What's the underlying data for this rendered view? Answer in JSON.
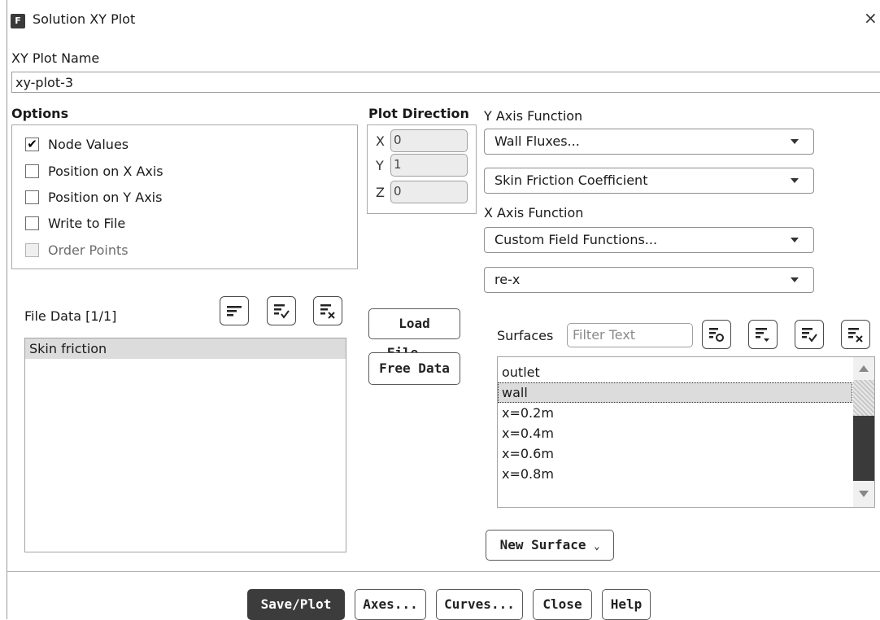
{
  "window": {
    "app_icon": "F",
    "title": "Solution XY Plot",
    "close_glyph": "×"
  },
  "plot_name": {
    "label": "XY Plot Name",
    "value": "xy-plot-3"
  },
  "options": {
    "label": "Options",
    "items": [
      {
        "label": "Node Values",
        "checked": true,
        "disabled": false
      },
      {
        "label": "Position on X Axis",
        "checked": false,
        "disabled": false
      },
      {
        "label": "Position on Y Axis",
        "checked": false,
        "disabled": false
      },
      {
        "label": "Write to File",
        "checked": false,
        "disabled": false
      },
      {
        "label": "Order Points",
        "checked": false,
        "disabled": true
      }
    ]
  },
  "plot_direction": {
    "label": "Plot Direction",
    "x_label": "X",
    "x_value": "0",
    "y_label": "Y",
    "y_value": "1",
    "z_label": "Z",
    "z_value": "0"
  },
  "y_axis": {
    "label": "Y Axis Function",
    "category": "Wall Fluxes...",
    "function": "Skin Friction Coefficient"
  },
  "x_axis": {
    "label": "X Axis Function",
    "category": "Custom Field Functions...",
    "function": "re-x"
  },
  "file_data": {
    "label": "File Data",
    "count": "[1/1]",
    "items": [
      "Skin friction"
    ],
    "icons": [
      "list-icon",
      "select-all-icon",
      "deselect-all-icon"
    ]
  },
  "file_buttons": {
    "load": "Load File...",
    "free": "Free Data"
  },
  "surfaces": {
    "label": "Surfaces",
    "filter_placeholder": "Filter Text",
    "items": [
      "outlet",
      "wall",
      "x=0.2m",
      "x=0.4m",
      "x=0.6m",
      "x=0.8m"
    ],
    "selected": "wall",
    "new_surface": "New Surface"
  },
  "footer": {
    "save_plot": "Save/Plot",
    "axes": "Axes...",
    "curves": "Curves...",
    "close": "Close",
    "help": "Help"
  },
  "colors": {
    "selected_row": "#dcdcdc",
    "save_button_bg": "#3c3c3c",
    "scrollbar_thumb": "#3a3a3a"
  }
}
